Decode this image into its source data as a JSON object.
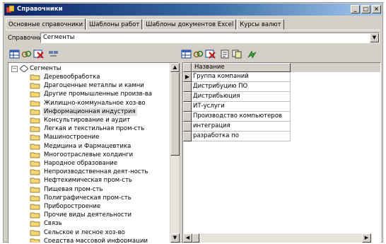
{
  "window": {
    "title": "Справочники",
    "buttons": {
      "minimize": "_",
      "maximize": "□",
      "close": "×"
    }
  },
  "tabs": [
    "Основные справочники",
    "Шаблоны работ",
    "Шаблоны документов Excel",
    "Курсы валют"
  ],
  "reference": {
    "label": "Справочник:",
    "value": "Сегменты"
  },
  "left_toolbar": [
    "grid-icon",
    "link-icon",
    "delete-icon",
    "find-icon"
  ],
  "right_toolbar": [
    "grid-icon",
    "link-icon",
    "delete-icon",
    "edit-icon",
    "copy-icon",
    "refresh-icon"
  ],
  "tree": {
    "root": "Сегменты",
    "items": [
      "Деревообработка",
      "Драгоценные металлы и камни",
      "Другие промышленные произв-ва",
      "Жилищно-коммунальное хоз-во",
      "Информационная индустрия",
      "Консультирование и аудит",
      "Легкая и текстильная пром-сть",
      "Машиностроение",
      "Медицина и Фармацевтика",
      "Многоотраслевые холдинги",
      "Народное образование",
      "Непроизводственная деят-ность",
      "Нефтехимическая пром-сть",
      "Пищевая пром-сть",
      "Полиграфическая пром-сть",
      "Приборостроение",
      "Прочие виды деятельности",
      "Связь",
      "Сельское и лесное хоз-во",
      "Средства массовой информации"
    ],
    "selected_index": 4
  },
  "grid": {
    "column": "Название",
    "current_marker": "▶",
    "rows": [
      "Группа компаний",
      "Дистрибуцию ПО",
      "Дистрибьюция",
      "ИТ-услуги",
      "Производство компьютеров",
      "интеграция",
      "разработка по"
    ]
  },
  "colors": {
    "title_start": "#0a246a",
    "title_end": "#a6caf0",
    "face": "#d4d0c8",
    "folder": "#f6d86e"
  }
}
